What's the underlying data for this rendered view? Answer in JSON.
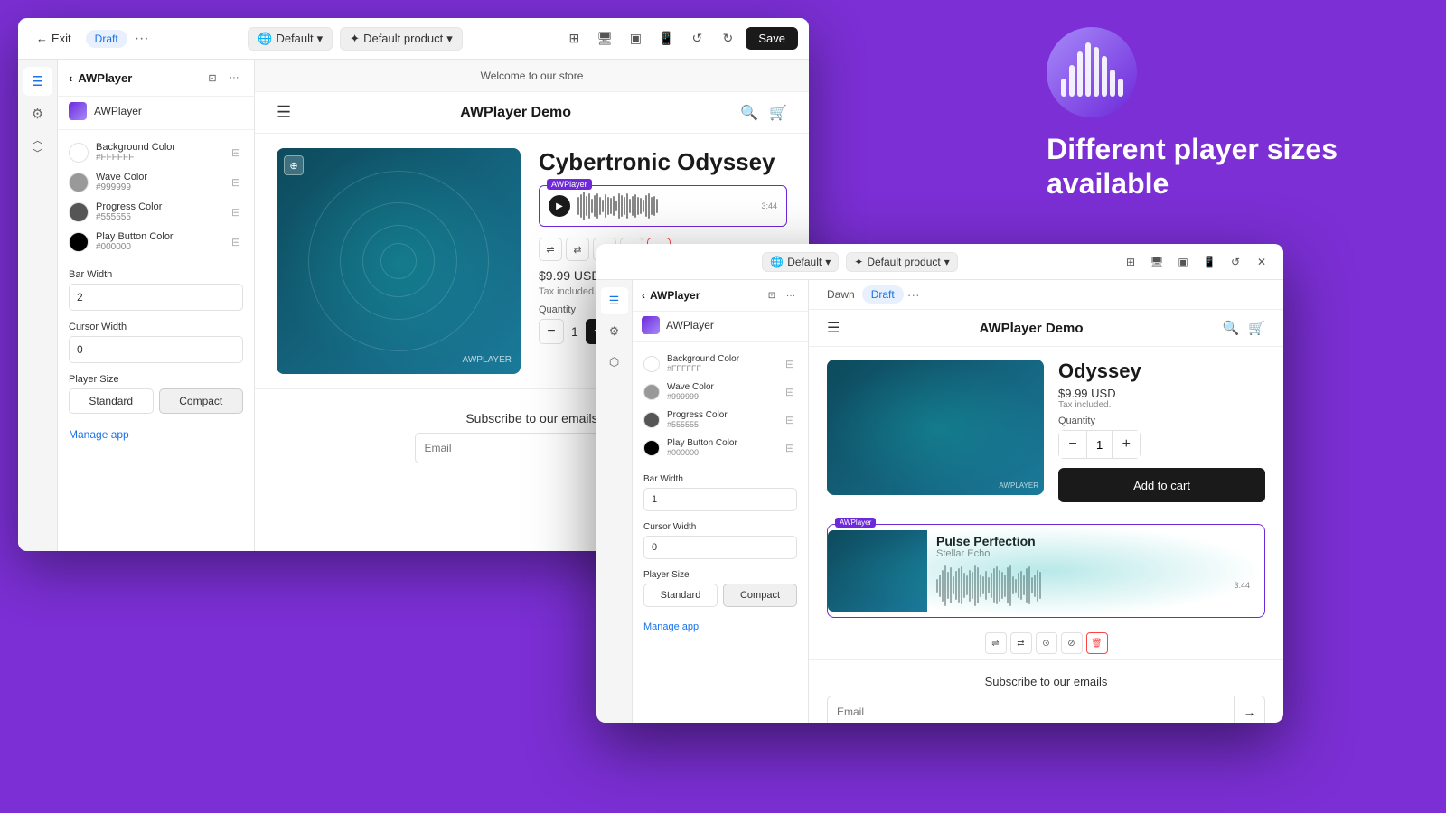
{
  "app": {
    "title": "AWPlayer",
    "app_name": "AWPlayer",
    "exit_label": "Exit",
    "draft_label": "Draft",
    "save_label": "Save",
    "more_dots": "···"
  },
  "header": {
    "default_label": "Default",
    "default_product_label": "Default product"
  },
  "panel": {
    "back_label": "AWPlayer",
    "app_label": "AWPlayer",
    "colors": [
      {
        "label": "Background Color",
        "hex": "#FFFFFF",
        "swatch": "#FFFFFF"
      },
      {
        "label": "Wave Color",
        "hex": "#999999",
        "swatch": "#999999"
      },
      {
        "label": "Progress Color",
        "hex": "#555555",
        "swatch": "#555555"
      },
      {
        "label": "Play Button Color",
        "hex": "#000000",
        "swatch": "#000000"
      }
    ],
    "bar_width_label": "Bar Width",
    "bar_width_value": "2",
    "cursor_width_label": "Cursor Width",
    "cursor_width_value": "0",
    "player_size_label": "Player Size",
    "standard_label": "Standard",
    "compact_label": "Compact",
    "manage_app_label": "Manage app"
  },
  "store": {
    "welcome_text": "Welcome to our store",
    "store_name": "AWPlayer Demo",
    "product_name": "Cybertronic Odyssey",
    "price": "$9.99 USD",
    "tax_text": "Tax included.",
    "quantity_label": "Quantity",
    "qty_value": "1",
    "player_label": "AWPlayer",
    "subscribe_title": "Subscribe to our emails",
    "email_placeholder": "Email"
  },
  "secondary": {
    "dawn_label": "Dawn",
    "draft_label": "Draft",
    "store_name": "AWPlayer Demo",
    "product_name": "Odyssey",
    "price": "$9.99 USD",
    "tax_text": "Tax included.",
    "quantity_label": "Quantity",
    "qty_value": "1",
    "add_to_cart_label": "Add to cart",
    "compact_track": "Pulse Perfection",
    "compact_artist": "Stellar Echo",
    "player_label": "AWPlayer",
    "subscribe_title": "Subscribe to our emails",
    "email_placeholder": "Email"
  },
  "tagline": {
    "line1": "Different player sizes",
    "line2": "available"
  }
}
